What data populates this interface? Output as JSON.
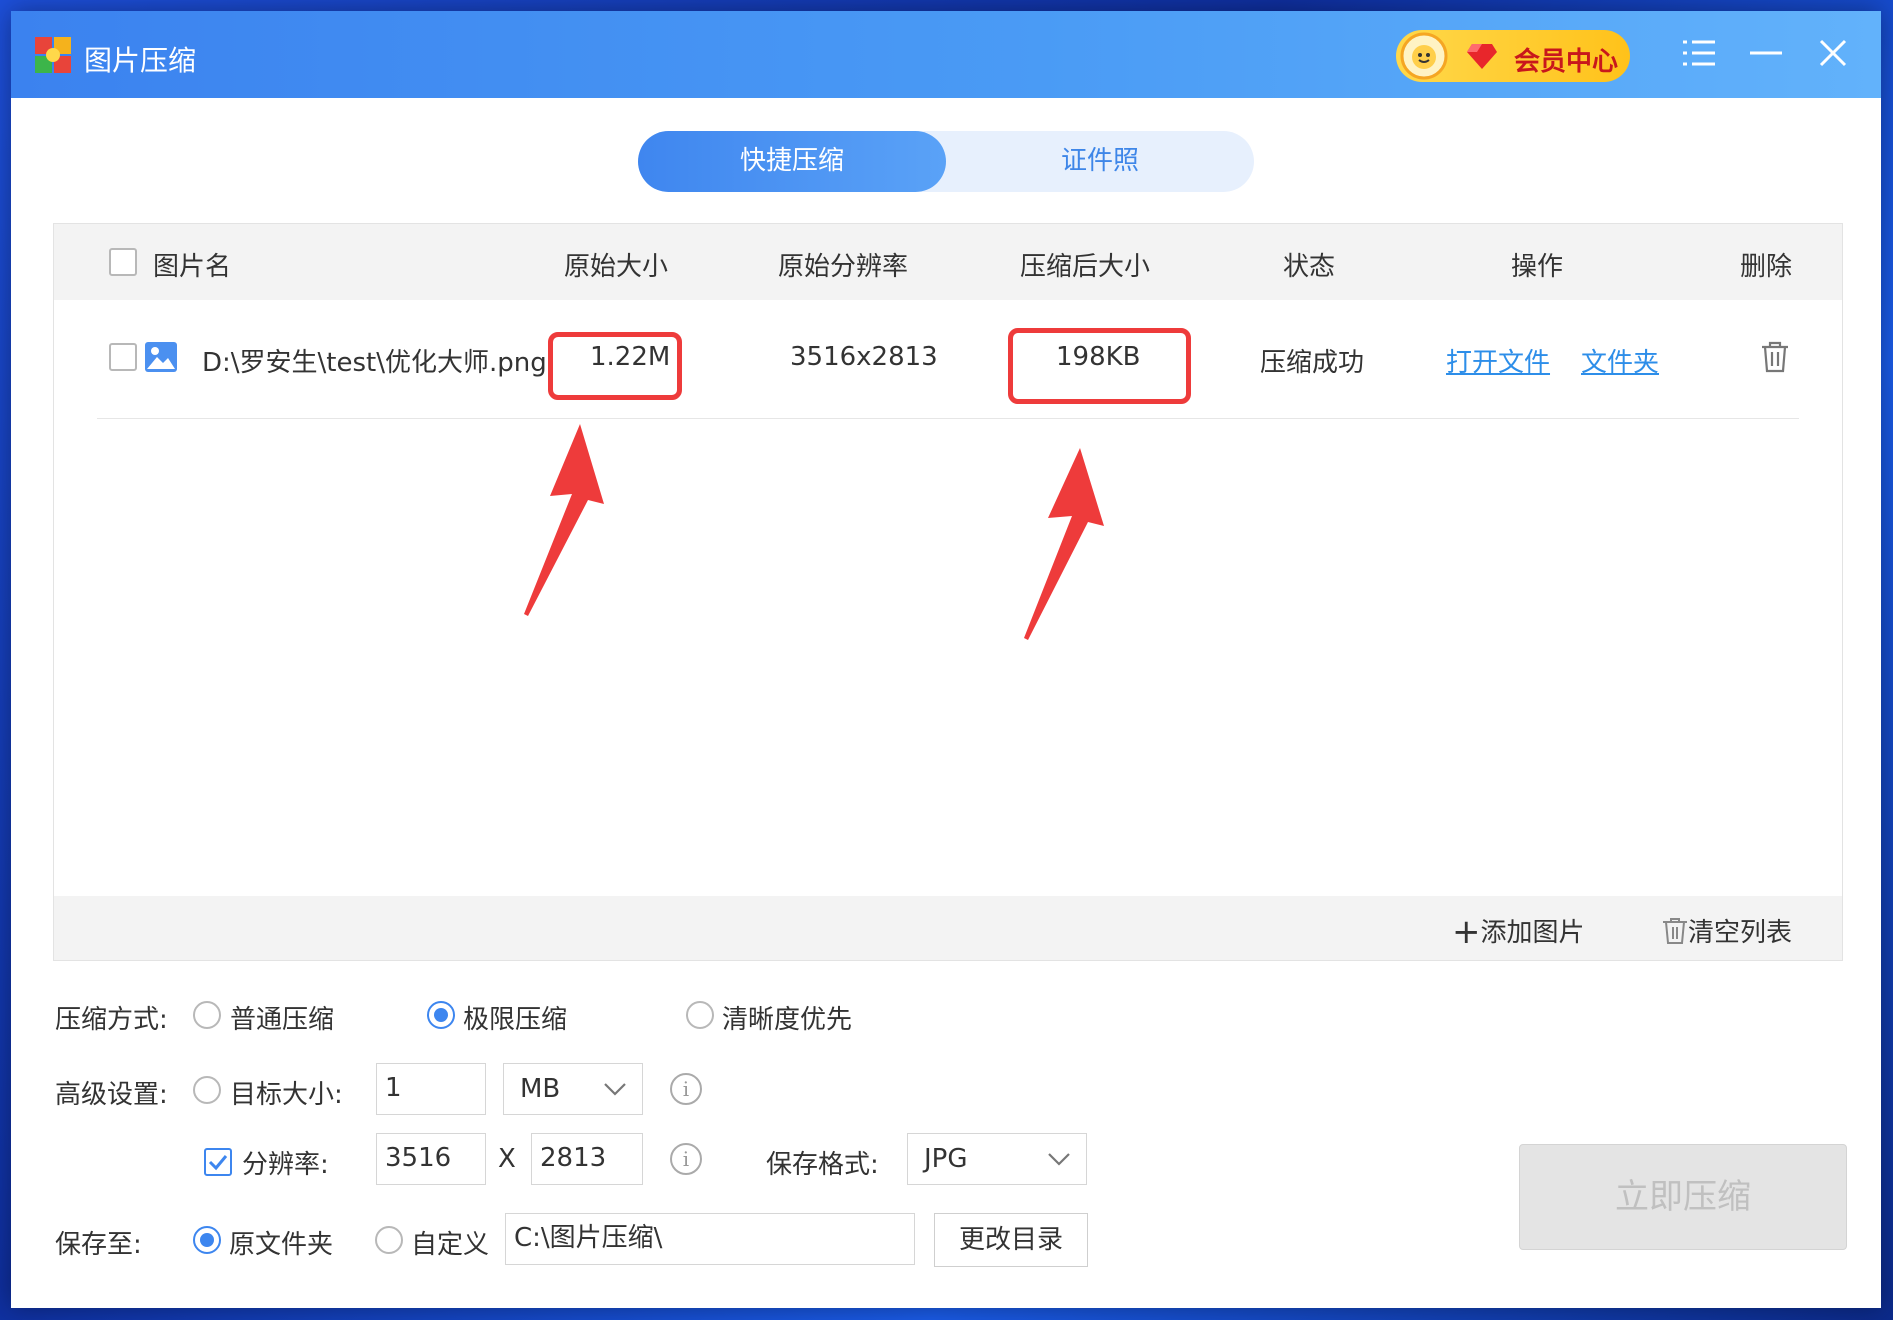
{
  "window": {
    "title": "图片压缩"
  },
  "vip": {
    "label": "会员中心"
  },
  "tabs": [
    {
      "label": "快捷压缩"
    },
    {
      "label": "证件照"
    }
  ],
  "table": {
    "headers": [
      "图片名",
      "原始大小",
      "原始分辨率",
      "压缩后大小",
      "状态",
      "操作",
      "删除"
    ],
    "rows": [
      {
        "name": "D:\\罗安生\\test\\优化大师.png",
        "original_size": "1.22M",
        "resolution": "3516x2813",
        "compressed_size": "198KB",
        "status": "压缩成功",
        "action_open": "打开文件",
        "action_folder": "文件夹"
      }
    ]
  },
  "footer": {
    "add": "添加图片",
    "clear": "清空列表"
  },
  "compress_mode": {
    "label": "压缩方式:",
    "options": [
      "普通压缩",
      "极限压缩",
      "清晰度优先"
    ],
    "selected": "极限压缩"
  },
  "advanced": {
    "label": "高级设置:",
    "target_label": "目标大小:",
    "target_value": "1",
    "target_unit": "MB",
    "resolution_label": "分辨率:",
    "width": "3516",
    "x": "X",
    "height": "2813",
    "format_label": "保存格式:",
    "format": "JPG"
  },
  "save": {
    "label": "保存至:",
    "option_original": "原文件夹",
    "option_custom": "自定义",
    "path": "C:\\图片压缩\\",
    "change_button": "更改目录"
  },
  "start_button": "立即压缩",
  "colors": {
    "accent": "#3d86ef",
    "highlight": "#ee3b3b",
    "link": "#2d8ee9"
  }
}
